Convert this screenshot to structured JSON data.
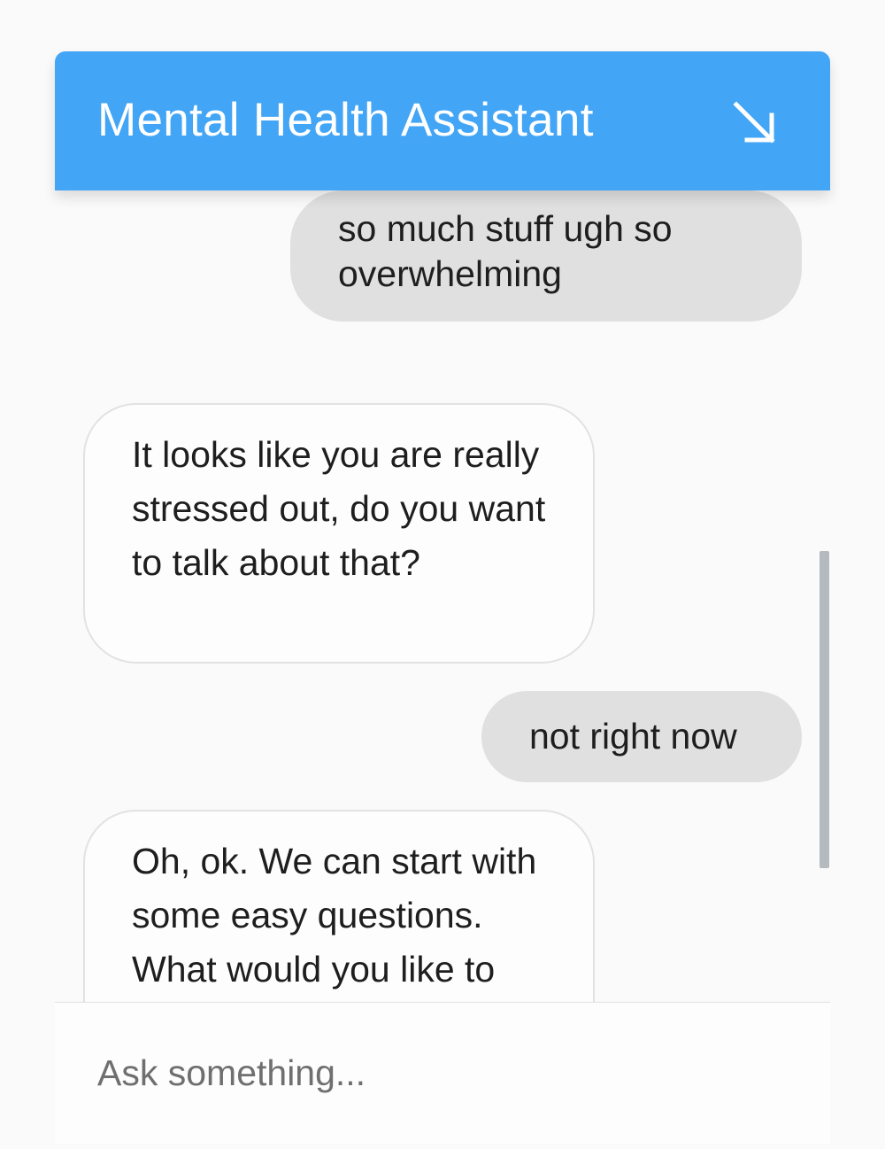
{
  "header": {
    "title": "Mental Health Assistant",
    "minimize_icon": "arrow-down-right-icon",
    "background_color": "#42a5f5"
  },
  "messages": [
    {
      "sender": "user",
      "text": "so much stuff ugh so overwhelming"
    },
    {
      "sender": "bot",
      "text": "It looks like you are really stressed out, do you want to talk about that?"
    },
    {
      "sender": "user",
      "text": "not right now"
    },
    {
      "sender": "bot",
      "text": "Oh, ok. We can start with some easy questions. What would you like to talk about?"
    }
  ],
  "input": {
    "value": "",
    "placeholder": "Ask something..."
  },
  "colors": {
    "user_bubble": "#e0e0e0",
    "bot_bubble": "#fdfdfd",
    "page_background": "#fafafa"
  }
}
